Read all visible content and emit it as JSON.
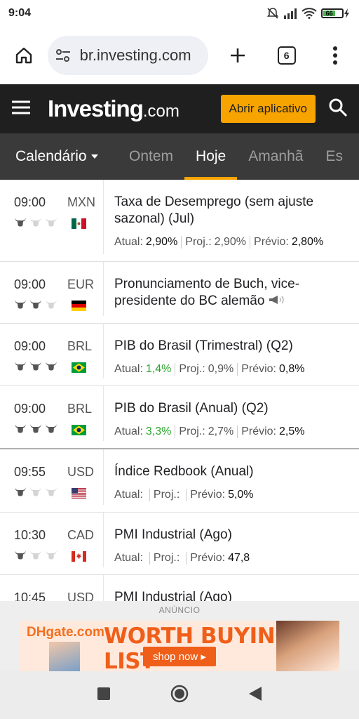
{
  "status_bar": {
    "time": "9:04",
    "battery": "66"
  },
  "browser": {
    "url": "br.investing.com",
    "tab_count": "6"
  },
  "header": {
    "logo_main": "Investing",
    "logo_suffix": ".com",
    "open_app": "Abrir aplicativo"
  },
  "tabs": {
    "calendar": "Calendário",
    "items": [
      "Ontem",
      "Hoje",
      "Amanhã",
      "Es"
    ],
    "active": "Hoje"
  },
  "labels": {
    "actual": "Atual:",
    "forecast": "Proj.:",
    "previous": "Prévio:"
  },
  "events": [
    {
      "time": "09:00",
      "currency": "MXN",
      "importance": 1,
      "country": "mexico",
      "title": "Taxa de Desemprego (sem ajuste sazonal) (Jul)",
      "actual": "2,90%",
      "forecast": "2,90%",
      "previous": "2,80%",
      "actual_color": "#111111"
    },
    {
      "time": "09:00",
      "currency": "EUR",
      "importance": 2,
      "country": "germany",
      "title": "Pronunciamento de Buch, vice-presidente do BC alemão",
      "speech": true
    },
    {
      "time": "09:00",
      "currency": "BRL",
      "importance": 3,
      "country": "brazil",
      "title": "PIB do Brasil (Trimestral) (Q2)",
      "actual": "1,4%",
      "forecast": "0,9%",
      "previous": "0,8%",
      "actual_color": "#2aa52a"
    },
    {
      "time": "09:00",
      "currency": "BRL",
      "importance": 3,
      "country": "brazil",
      "title": "PIB do Brasil (Anual) (Q2)",
      "actual": "3,3%",
      "forecast": "2,7%",
      "previous": "2,5%",
      "actual_color": "#2aa52a"
    },
    {
      "time": "09:55",
      "currency": "USD",
      "importance": 1,
      "country": "usa",
      "title": "Índice Redbook (Anual)",
      "actual": "",
      "forecast": "",
      "previous": "5,0%"
    },
    {
      "time": "10:30",
      "currency": "CAD",
      "importance": 1,
      "country": "canada",
      "title": "PMI Industrial (Ago)",
      "actual": "",
      "forecast": "",
      "previous": "47,8"
    },
    {
      "time": "10:45",
      "currency": "USD",
      "importance": 1,
      "country": "usa",
      "title": "PMI Industrial (Ago)"
    }
  ],
  "ad": {
    "label": "ANÚNCIO",
    "brand_main": "DH",
    "brand_rest": "gate.com",
    "headline": "WORTH BUYING LIST",
    "cta": "shop now ▸"
  },
  "colors": {
    "accent": "#f7a400",
    "header_bg": "#1f1f1f",
    "tabs_bg": "#3a3a3a",
    "positive": "#2aa52a"
  }
}
